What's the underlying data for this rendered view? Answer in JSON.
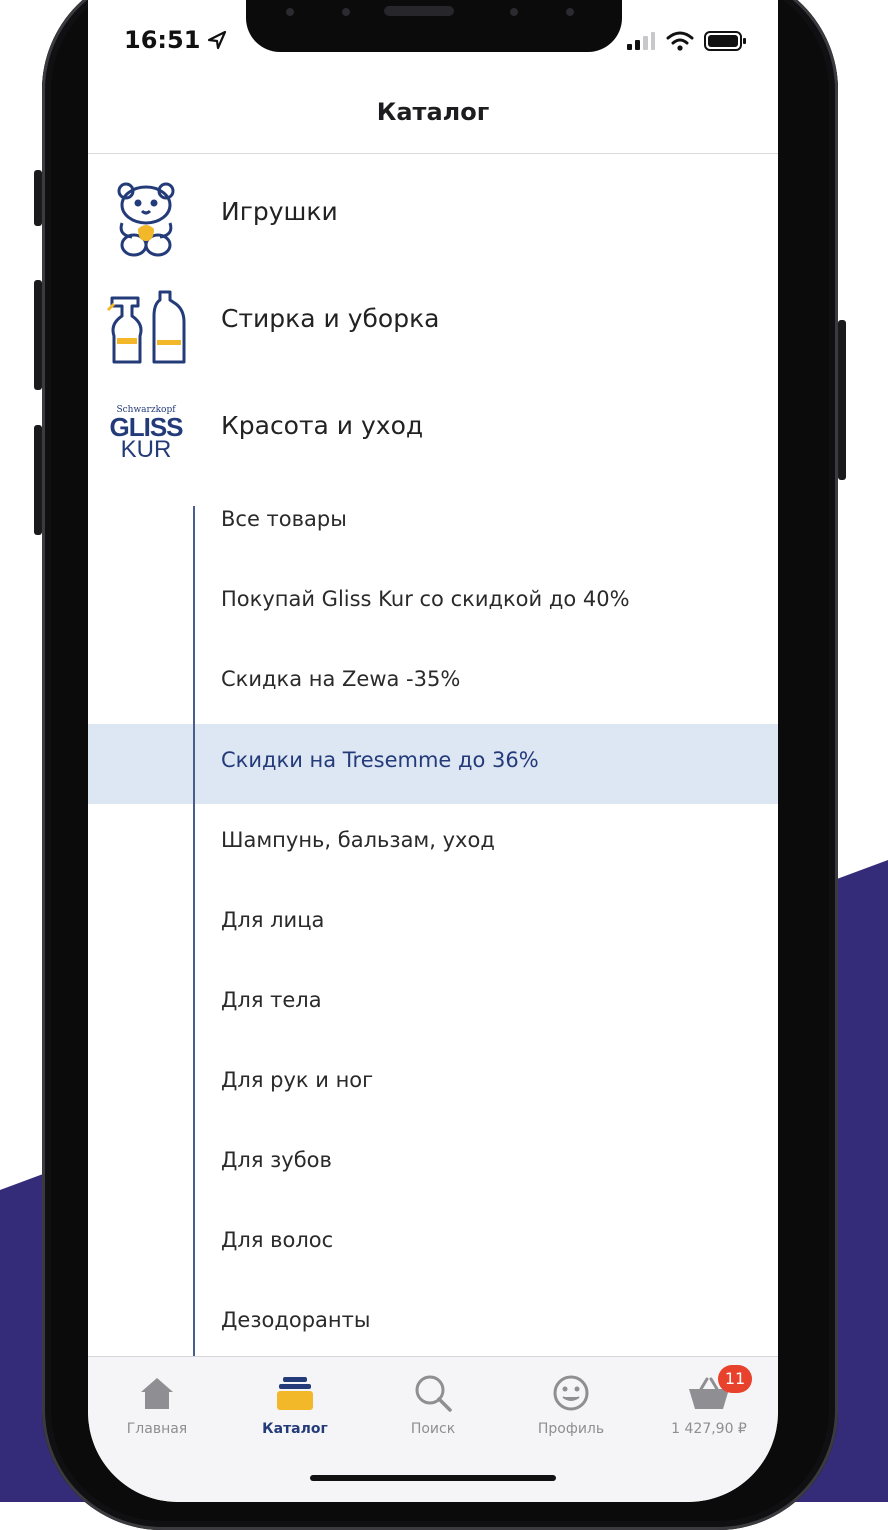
{
  "colors": {
    "brand_navy": "#342c78",
    "accent_blue": "#243b7a",
    "highlight_bg": "#dde6f3",
    "tab_active_yellow": "#f2b829",
    "badge_red": "#e8412c"
  },
  "status_bar": {
    "time": "16:51",
    "icons": [
      "location-arrow-icon",
      "signal-icon",
      "wifi-icon",
      "battery-icon"
    ]
  },
  "header": {
    "title": "Каталог"
  },
  "categories": [
    {
      "label": "Игрушки",
      "icon": "teddy-bear-icon"
    },
    {
      "label": "Стирка и уборка",
      "icon": "cleaning-bottles-icon"
    },
    {
      "label": "Красота и уход",
      "icon": "gliss-kur-logo",
      "logo_text": {
        "top": "Schwarzkopf",
        "middle": "GLISS",
        "bottom": "KUR"
      }
    }
  ],
  "subcategories": [
    {
      "label": "Все товары",
      "active": false
    },
    {
      "label": "Покупай Gliss Kur со скидкой до 40%",
      "active": false
    },
    {
      "label": "Скидка на Zewa -35%",
      "active": false
    },
    {
      "label": "Скидки на Tresemme до 36%",
      "active": true
    },
    {
      "label": "Шампунь, бальзам, уход",
      "active": false
    },
    {
      "label": "Для лица",
      "active": false
    },
    {
      "label": "Для тела",
      "active": false
    },
    {
      "label": "Для рук и ног",
      "active": false
    },
    {
      "label": "Для зубов",
      "active": false
    },
    {
      "label": "Для волос",
      "active": false
    },
    {
      "label": "Дезодоранты",
      "active": false
    }
  ],
  "tabbar": {
    "tabs": [
      {
        "label": "Главная",
        "icon": "home-icon",
        "active": false
      },
      {
        "label": "Каталог",
        "icon": "catalog-icon",
        "active": true
      },
      {
        "label": "Поиск",
        "icon": "search-icon",
        "active": false
      },
      {
        "label": "Профиль",
        "icon": "smiley-icon",
        "active": false
      },
      {
        "label": "1 427,90 ₽",
        "icon": "basket-icon",
        "active": false,
        "badge": "11"
      }
    ]
  }
}
